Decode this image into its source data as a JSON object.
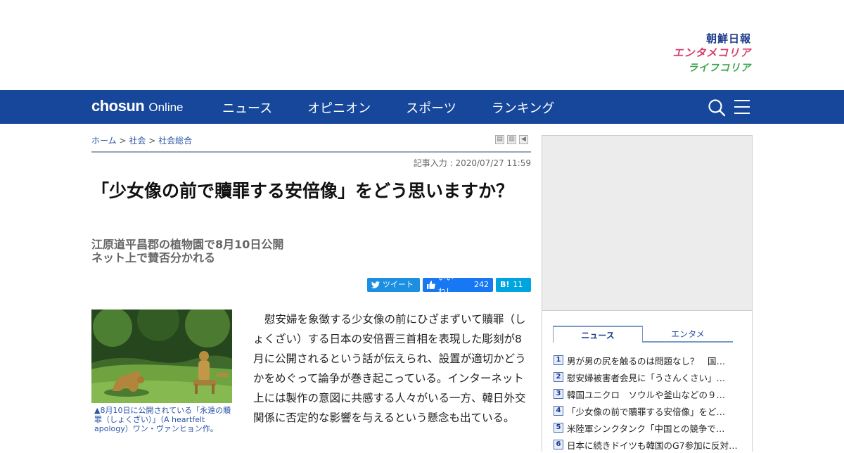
{
  "brands": {
    "chosun_ilbo": "朝鮮日報",
    "entame_korea": "エンタメコリア",
    "life_korea": "ライフコリア"
  },
  "nav": {
    "logo_bold": "chosun",
    "logo_light": "Online",
    "items": [
      "ニュース",
      "オピニオン",
      "スポーツ",
      "ランキング"
    ]
  },
  "breadcrumb": {
    "home": "ホーム",
    "sep": ">",
    "section": "社会",
    "subsection": "社会総合"
  },
  "article": {
    "date": "記事入力 : 2020/07/27 11:59",
    "title": "「少女像の前で贖罪する安倍像」をどう思いますか？",
    "subtitle_1": "江原道平昌郡の植物園で8月10日公開",
    "subtitle_2": "ネット上で賛否分かれる",
    "photo_caption": "▲8月10日に公開されている「永遠の贖罪（しょくざい）」（A heartfelt apology）ワン・ヴァンヒョン作。",
    "body": "慰安婦を象徴する少女像の前にひざまずいて贖罪（しょくざい）する日本の安倍晋三首相を表現した彫刻が8月に公開されるという話が伝えられ、設置が適切かどうかをめぐって論争が巻き起こっている。インターネット上には製作の意図に共感する人々がいる一方、韓日外交関係に否定的な影響を与えるという懸念も出ている。"
  },
  "share": {
    "tweet": "ツイート",
    "like": "いいね！",
    "like_count": "242",
    "hatena": "B!",
    "hatena_count": "11"
  },
  "ranking": {
    "tab_news": "ニュース",
    "tab_entame": "エンタメ",
    "items": [
      {
        "num": "1",
        "text": "男が男の尻を触るのは問題なし？　国…"
      },
      {
        "num": "2",
        "text": "慰安婦被害者会見に「うさんくさい」…"
      },
      {
        "num": "3",
        "text": "韓国ユニクロ　ソウルや釜山などの９…"
      },
      {
        "num": "4",
        "text": "「少女像の前で贖罪する安倍像」をど…"
      },
      {
        "num": "5",
        "text": "米陸軍シンクタンク「中国との競争で…"
      },
      {
        "num": "6",
        "text": "日本に続きドイツも韓国のG7参加に反対…"
      }
    ]
  },
  "colors": {
    "nav_bg": "#16479b",
    "link": "#2a53a8",
    "brand_pink": "#d63c6a",
    "brand_green": "#3aa44a"
  }
}
